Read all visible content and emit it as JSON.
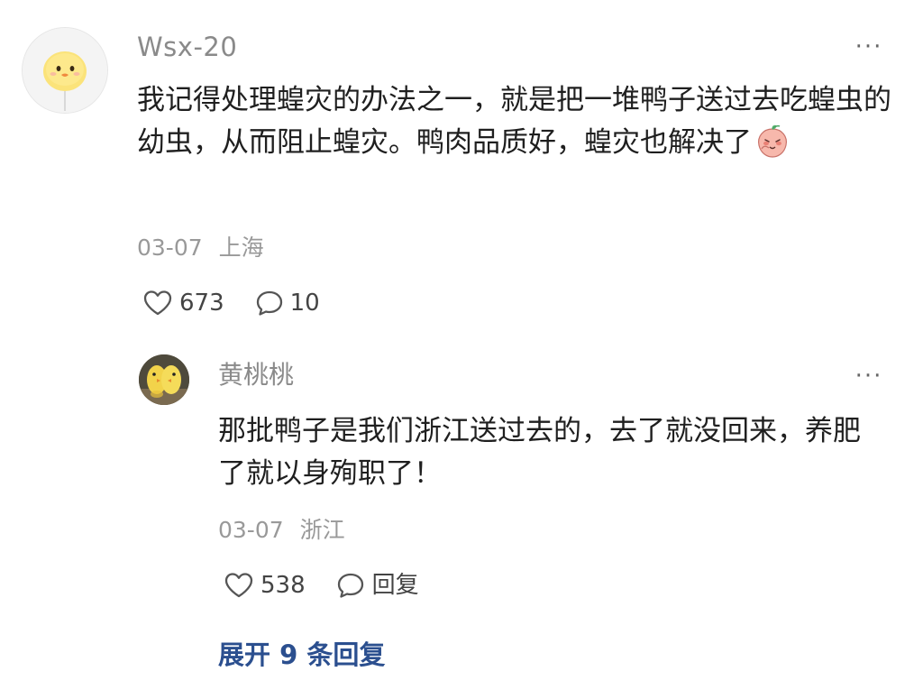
{
  "comment": {
    "username": "Wsx-20",
    "more": "···",
    "text": "我记得处理蝗灾的办法之一，就是把一堆鸭子送过去吃蝗虫的幼虫，从而阻止蝗灾。鸭肉品质好，蝗灾也解决了",
    "emoji": "peach-shy-emoji",
    "date": "03-07",
    "location": "上海",
    "likes": "673",
    "replies": "10",
    "icons": {
      "like": "heart-icon",
      "comment": "comment-bubble-icon",
      "more": "more-icon"
    }
  },
  "reply": {
    "username": "黄桃桃",
    "more": "···",
    "text": "那批鸭子是我们浙江送过去的，去了就没回来，养肥了就以身殉职了！",
    "date": "03-07",
    "location": "浙江",
    "likes": "538",
    "reply_label": "回复"
  },
  "expand_label": "展开 9 条回复",
  "colors": {
    "link": "#2b4f8f",
    "meta": "#999999",
    "username": "#8a8a8a",
    "text": "#1f1f1f"
  }
}
